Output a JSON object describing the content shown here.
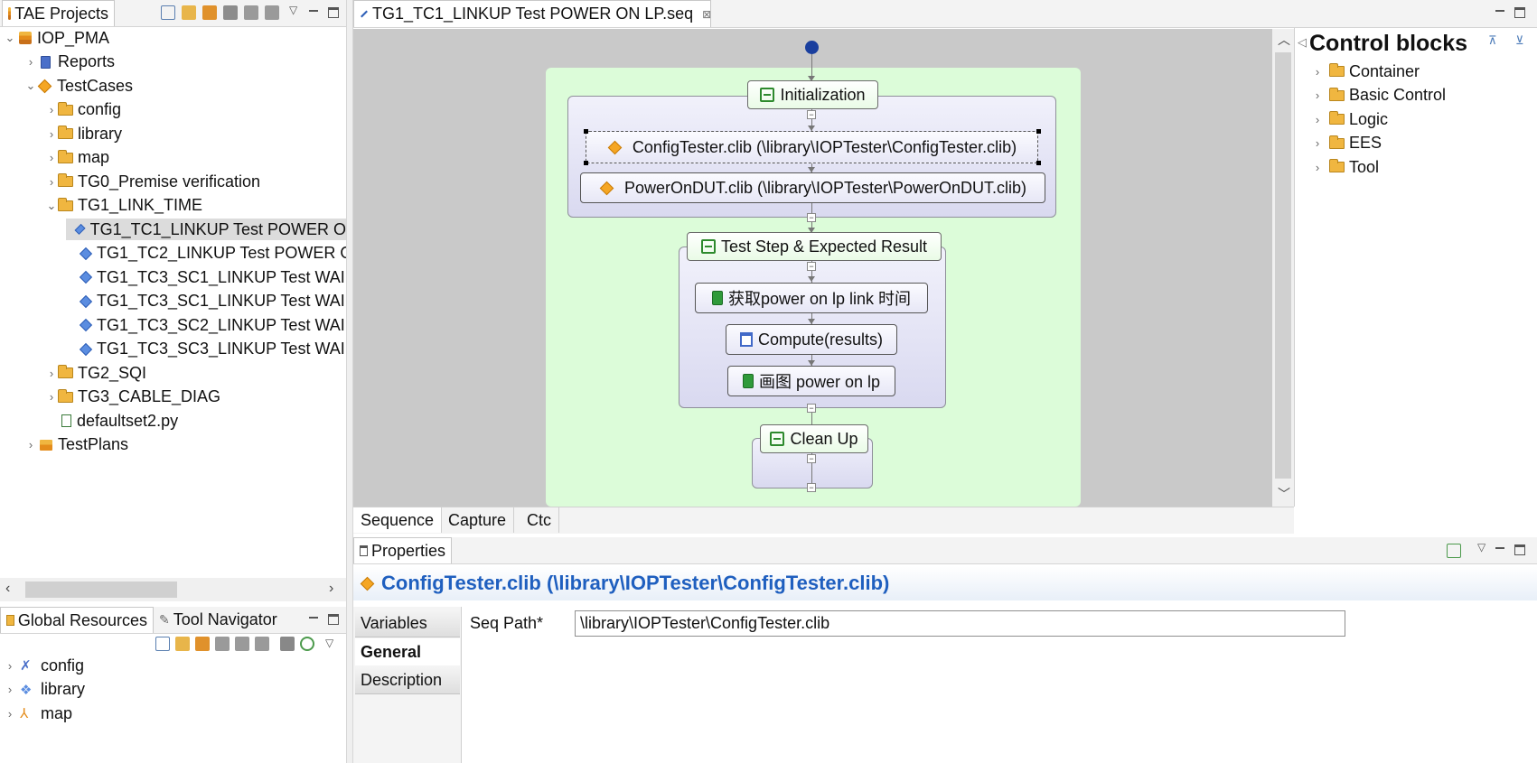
{
  "left_panel": {
    "tab_label": "TAE Projects",
    "tree": [
      {
        "label": "IOP_PMA",
        "chev": "⌄",
        "icon": "project"
      },
      {
        "label": "Reports",
        "chev": "›",
        "icon": "report"
      },
      {
        "label": "TestCases",
        "chev": "⌄",
        "icon": "testcases"
      },
      {
        "label": "config",
        "chev": "›",
        "icon": "folder"
      },
      {
        "label": "library",
        "chev": "›",
        "icon": "folder"
      },
      {
        "label": "map",
        "chev": "›",
        "icon": "folder"
      },
      {
        "label": "TG0_Premise verification",
        "chev": "›",
        "icon": "folder"
      },
      {
        "label": "TG1_LINK_TIME",
        "chev": "⌄",
        "icon": "folder"
      },
      {
        "label": "TG1_TC1_LINKUP Test POWER O",
        "chev": "",
        "icon": "seq",
        "selected": true
      },
      {
        "label": "TG1_TC2_LINKUP Test POWER O",
        "chev": "",
        "icon": "seq"
      },
      {
        "label": "TG1_TC3_SC1_LINKUP Test WAI",
        "chev": "",
        "icon": "seq"
      },
      {
        "label": "TG1_TC3_SC1_LINKUP Test WAI",
        "chev": "",
        "icon": "seq"
      },
      {
        "label": "TG1_TC3_SC2_LINKUP Test WAI",
        "chev": "",
        "icon": "seq"
      },
      {
        "label": "TG1_TC3_SC3_LINKUP Test WAI",
        "chev": "",
        "icon": "seq"
      },
      {
        "label": "TG2_SQI",
        "chev": "›",
        "icon": "folder"
      },
      {
        "label": "TG3_CABLE_DIAG",
        "chev": "›",
        "icon": "folder"
      },
      {
        "label": "defaultset2.py",
        "chev": "",
        "icon": "python"
      },
      {
        "label": "TestPlans",
        "chev": "›",
        "icon": "testplans"
      }
    ]
  },
  "resources_panel": {
    "tab1": "Global Resources",
    "tab2": "Tool Navigator",
    "items": [
      {
        "label": "config",
        "icon": "config"
      },
      {
        "label": "library",
        "icon": "library"
      },
      {
        "label": "map",
        "icon": "map"
      }
    ]
  },
  "editor": {
    "tab_label": "TG1_TC1_LINKUP Test POWER ON LP.seq",
    "bottom_tabs": [
      "Sequence",
      "Capture",
      "Ctc"
    ],
    "diagram": {
      "initialization": "Initialization",
      "config_tester": "ConfigTester.clib (\\library\\IOPTester\\ConfigTester.clib)",
      "power_on_dut": "PowerOnDUT.clib (\\library\\IOPTester\\PowerOnDUT.clib)",
      "test_step": "Test Step & Expected Result",
      "get_power": "获取power on lp link 时间",
      "compute": "Compute(results)",
      "draw_power": "画图 power on lp",
      "clean_up": "Clean Up"
    }
  },
  "control_blocks": {
    "title": "Control blocks",
    "items": [
      "Container",
      "Basic Control",
      "Logic",
      "EES",
      "Tool"
    ]
  },
  "properties": {
    "tab_label": "Properties",
    "heading": "ConfigTester.clib (\\library\\IOPTester\\ConfigTester.clib)",
    "side_tabs": [
      "Variables",
      "General",
      "Description"
    ],
    "seq_path_label": "Seq Path*",
    "seq_path_value": "\\library\\IOPTester\\ConfigTester.clib"
  },
  "colors": {
    "green_area": "#dcfcd9",
    "canvas": "#c9c9c9",
    "heading_blue": "#1f5fbf",
    "accent_orange": "#f5a623"
  }
}
